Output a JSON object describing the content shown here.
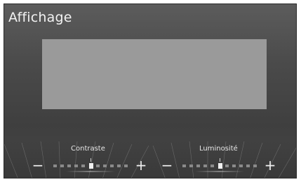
{
  "screen": {
    "title": "Affichage"
  },
  "controls": {
    "contrast": {
      "label": "Contraste",
      "minus": "−",
      "plus": "+",
      "level": 0.5,
      "steps": 11
    },
    "brightness": {
      "label": "Luminosité",
      "minus": "−",
      "plus": "+",
      "level": 0.5,
      "steps": 11
    }
  },
  "colors": {
    "background": "#4a4a4a",
    "preview": "#9a9a9a",
    "text": "#f2f2f2"
  }
}
